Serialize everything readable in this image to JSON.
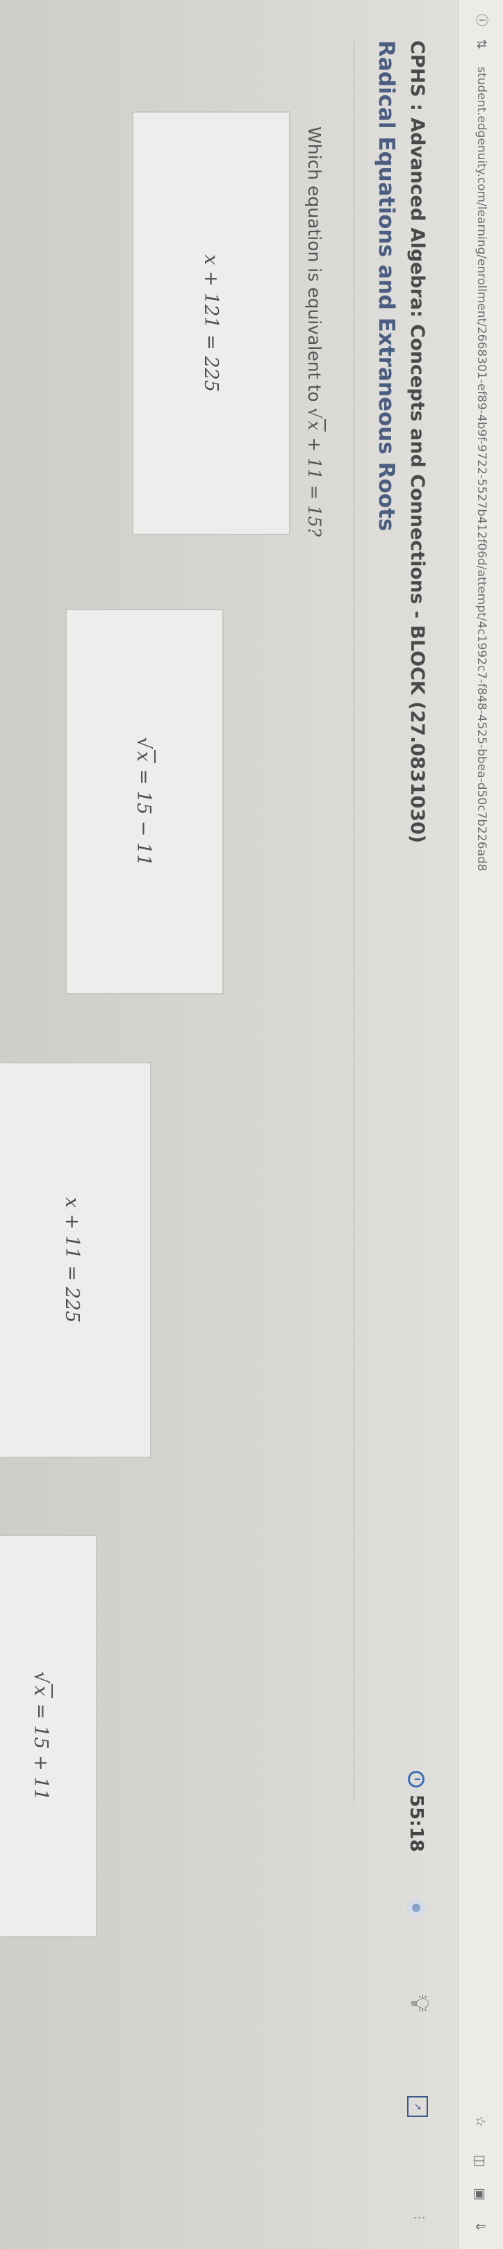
{
  "browser": {
    "url": "student.edgenuity.com/learning/enrollment/2668301-ef89-4b9f-9722-5527b412f06d/attempt/4c1992c7-f848-4525-bbea-d50c7b226ad8",
    "icons": [
      "info-icon",
      "tune-icon",
      "star-icon",
      "extension-icon",
      "tab-icon",
      "download-icon"
    ]
  },
  "header": {
    "course": "CPHS : Advanced Algebra: Concepts and Connections - BLOCK (27.0831030)",
    "lesson": "Radical Equations and Extraneous Roots"
  },
  "timer": {
    "time": "55:18"
  },
  "question": {
    "prefix": "Which equation is equivalent to",
    "radicand": "x",
    "rest": "+ 11 = 15?"
  },
  "choices": [
    {
      "label": "x + 121 = 225",
      "has_sqrt": false
    },
    {
      "label_sqrt": "x",
      "label_rest": "= 15 − 11",
      "has_sqrt": true
    },
    {
      "label": "x + 11 = 225",
      "has_sqrt": false
    },
    {
      "label_sqrt": "x",
      "label_rest": "= 15 + 11",
      "has_sqrt": true
    }
  ],
  "colors": {
    "lesson_title": "#4b5e82",
    "timer_accent": "#3b6fb6",
    "background": "#d9d7d3"
  }
}
